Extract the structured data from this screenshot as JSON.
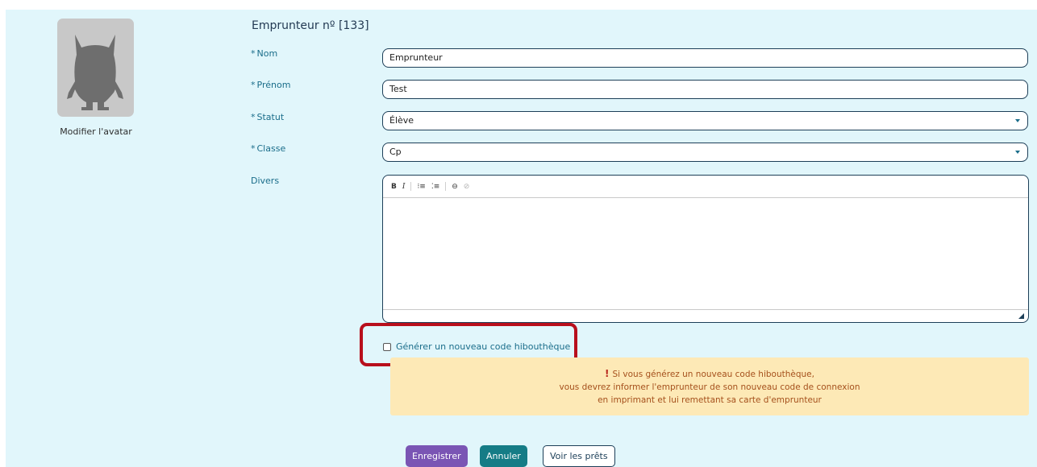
{
  "avatar": {
    "link_label": "Modifier l'avatar",
    "icon": "monster-icon"
  },
  "form": {
    "title": "Emprunteur nº [133]",
    "required_marker": "*",
    "fields": {
      "nom": {
        "label": "Nom",
        "value": "Emprunteur"
      },
      "prenom": {
        "label": "Prénom",
        "value": "Test"
      },
      "statut": {
        "label": "Statut",
        "value": "Élève"
      },
      "classe": {
        "label": "Classe",
        "value": "Cp"
      },
      "divers": {
        "label": "Divers",
        "value": ""
      }
    },
    "editor_toolbar": {
      "bold": "B",
      "italic": "I",
      "numbered_list": "⁝≡",
      "bulleted_list": "⁚≡",
      "link": "⊖",
      "unlink": "⊘"
    },
    "regenerate_checkbox": {
      "label": "Générer un nouveau code hibouthèque",
      "checked": false
    },
    "warning": {
      "icon": "!",
      "line1": "Si vous générez un nouveau code hibouthèque,",
      "line2": "vous devrez informer l'emprunteur de son nouveau code de connexion",
      "line3": "en imprimant et lui remettant sa carte d'emprunteur"
    },
    "buttons": {
      "save": "Enregistrer",
      "cancel": "Annuler",
      "loans": "Voir les prêts"
    }
  },
  "colors": {
    "panel_bg": "#e1f6fb",
    "save_button": "#7a55b4",
    "cancel_button": "#157c86",
    "highlight": "#b80f1c",
    "warning_bg": "#fde9b6"
  }
}
